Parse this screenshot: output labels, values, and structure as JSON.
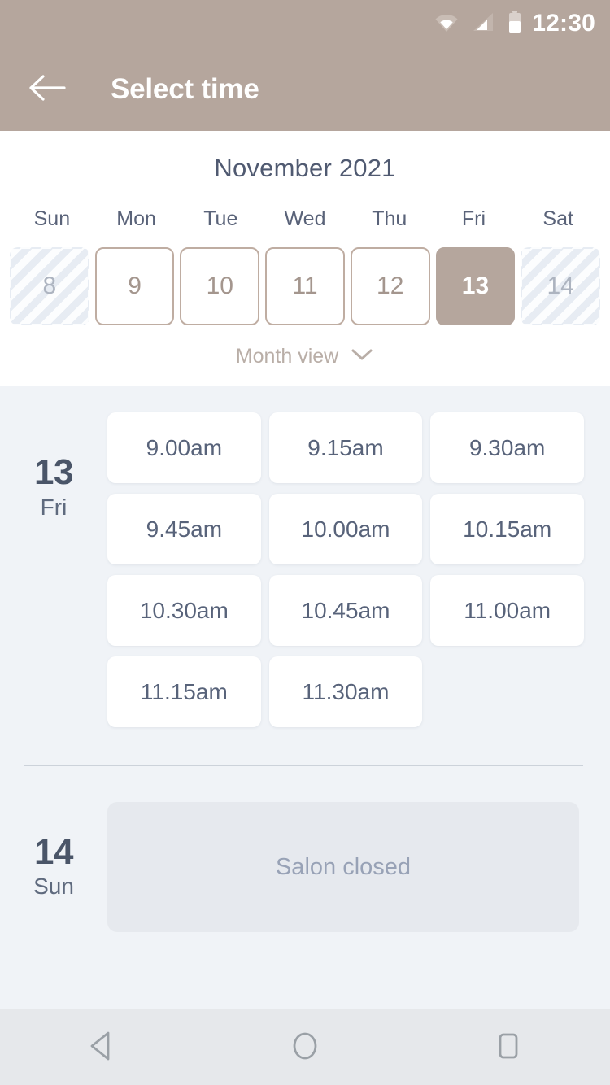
{
  "status_bar": {
    "clock": "12:30",
    "icons": [
      "wifi-icon",
      "cellular-signal-icon",
      "battery-icon"
    ]
  },
  "app_bar": {
    "back_icon": "arrow-left-icon",
    "title": "Select time"
  },
  "calendar": {
    "month_title": "November 2021",
    "weekdays": [
      "Sun",
      "Mon",
      "Tue",
      "Wed",
      "Thu",
      "Fri",
      "Sat"
    ],
    "days": [
      {
        "number": "8",
        "state": "disabled"
      },
      {
        "number": "9",
        "state": "available"
      },
      {
        "number": "10",
        "state": "available"
      },
      {
        "number": "11",
        "state": "available"
      },
      {
        "number": "12",
        "state": "available"
      },
      {
        "number": "13",
        "state": "selected"
      },
      {
        "number": "14",
        "state": "disabled"
      }
    ],
    "view_toggle": {
      "label": "Month view",
      "icon": "chevron-down-icon"
    }
  },
  "schedule": {
    "groups": [
      {
        "day_number": "13",
        "day_name": "Fri",
        "slots": [
          "9.00am",
          "9.15am",
          "9.30am",
          "9.45am",
          "10.00am",
          "10.15am",
          "10.30am",
          "10.45am",
          "11.00am",
          "11.15am",
          "11.30am"
        ]
      },
      {
        "day_number": "14",
        "day_name": "Sun",
        "closed_message": "Salon closed"
      }
    ]
  },
  "nav_bar": {
    "buttons": [
      "back-triangle-icon",
      "home-circle-icon",
      "recents-square-icon"
    ]
  },
  "colors": {
    "app_bar": "#b5a69d",
    "selected_day": "#b5a69d",
    "slot_background": "#f0f3f7",
    "slot_chip": "#ffffff",
    "closed_box": "#e6e9ee",
    "title_text": "#505a71",
    "day_border": "#bfada2"
  }
}
